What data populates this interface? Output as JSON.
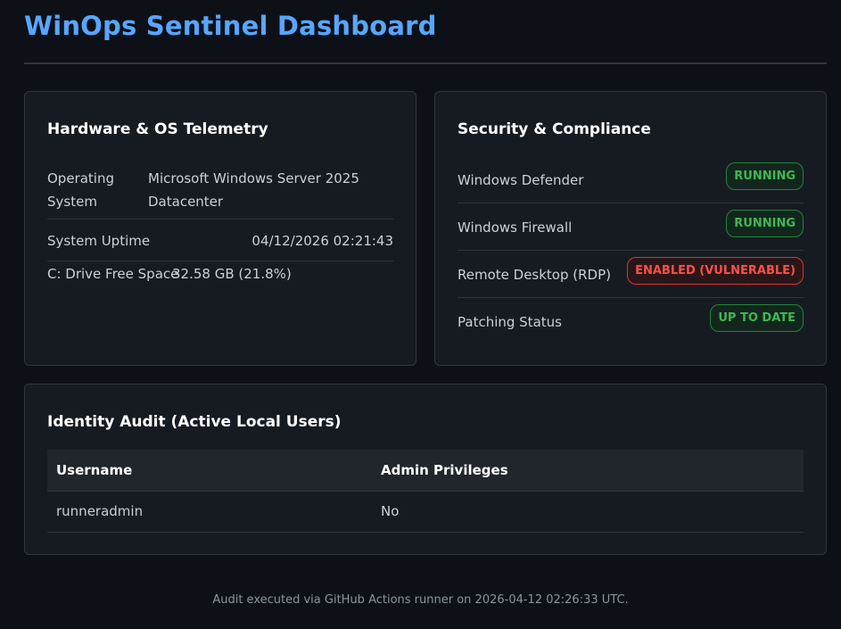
{
  "header": {
    "title": "WinOps Sentinel Dashboard"
  },
  "hardware": {
    "title": "Hardware & OS Telemetry",
    "rows": [
      {
        "label_line1": "Operating",
        "label_line2": "System",
        "value_line1": "Microsoft Windows Server 2025",
        "value_line2": "Datacenter"
      },
      {
        "label": "System Uptime",
        "value": "04/12/2026 02:21:43"
      },
      {
        "label": "C: Drive Free Space",
        "value": "32.58 GB (21.8%)"
      }
    ]
  },
  "security": {
    "title": "Security & Compliance",
    "rows": [
      {
        "label": "Windows Defender",
        "status": "RUNNING",
        "state": "ok"
      },
      {
        "label": "Windows Firewall",
        "status": "RUNNING",
        "state": "ok"
      },
      {
        "label": "Remote Desktop (RDP)",
        "status": "ENABLED (VULNERABLE)",
        "state": "bad"
      },
      {
        "label": "Patching Status",
        "status": "UP TO DATE",
        "state": "ok"
      }
    ]
  },
  "identity": {
    "title": "Identity Audit (Active Local Users)",
    "columns": [
      "Username",
      "Admin Privileges"
    ],
    "rows": [
      [
        "runneradmin",
        "No"
      ]
    ]
  },
  "footer": {
    "text": "Audit executed via GitHub Actions runner on 2026-04-12 02:26:33 UTC."
  },
  "colors": {
    "accent": "#58a6ff",
    "ok": "#3fb950",
    "bad": "#f85149",
    "background": "#0d1117",
    "card": "#161b22"
  }
}
